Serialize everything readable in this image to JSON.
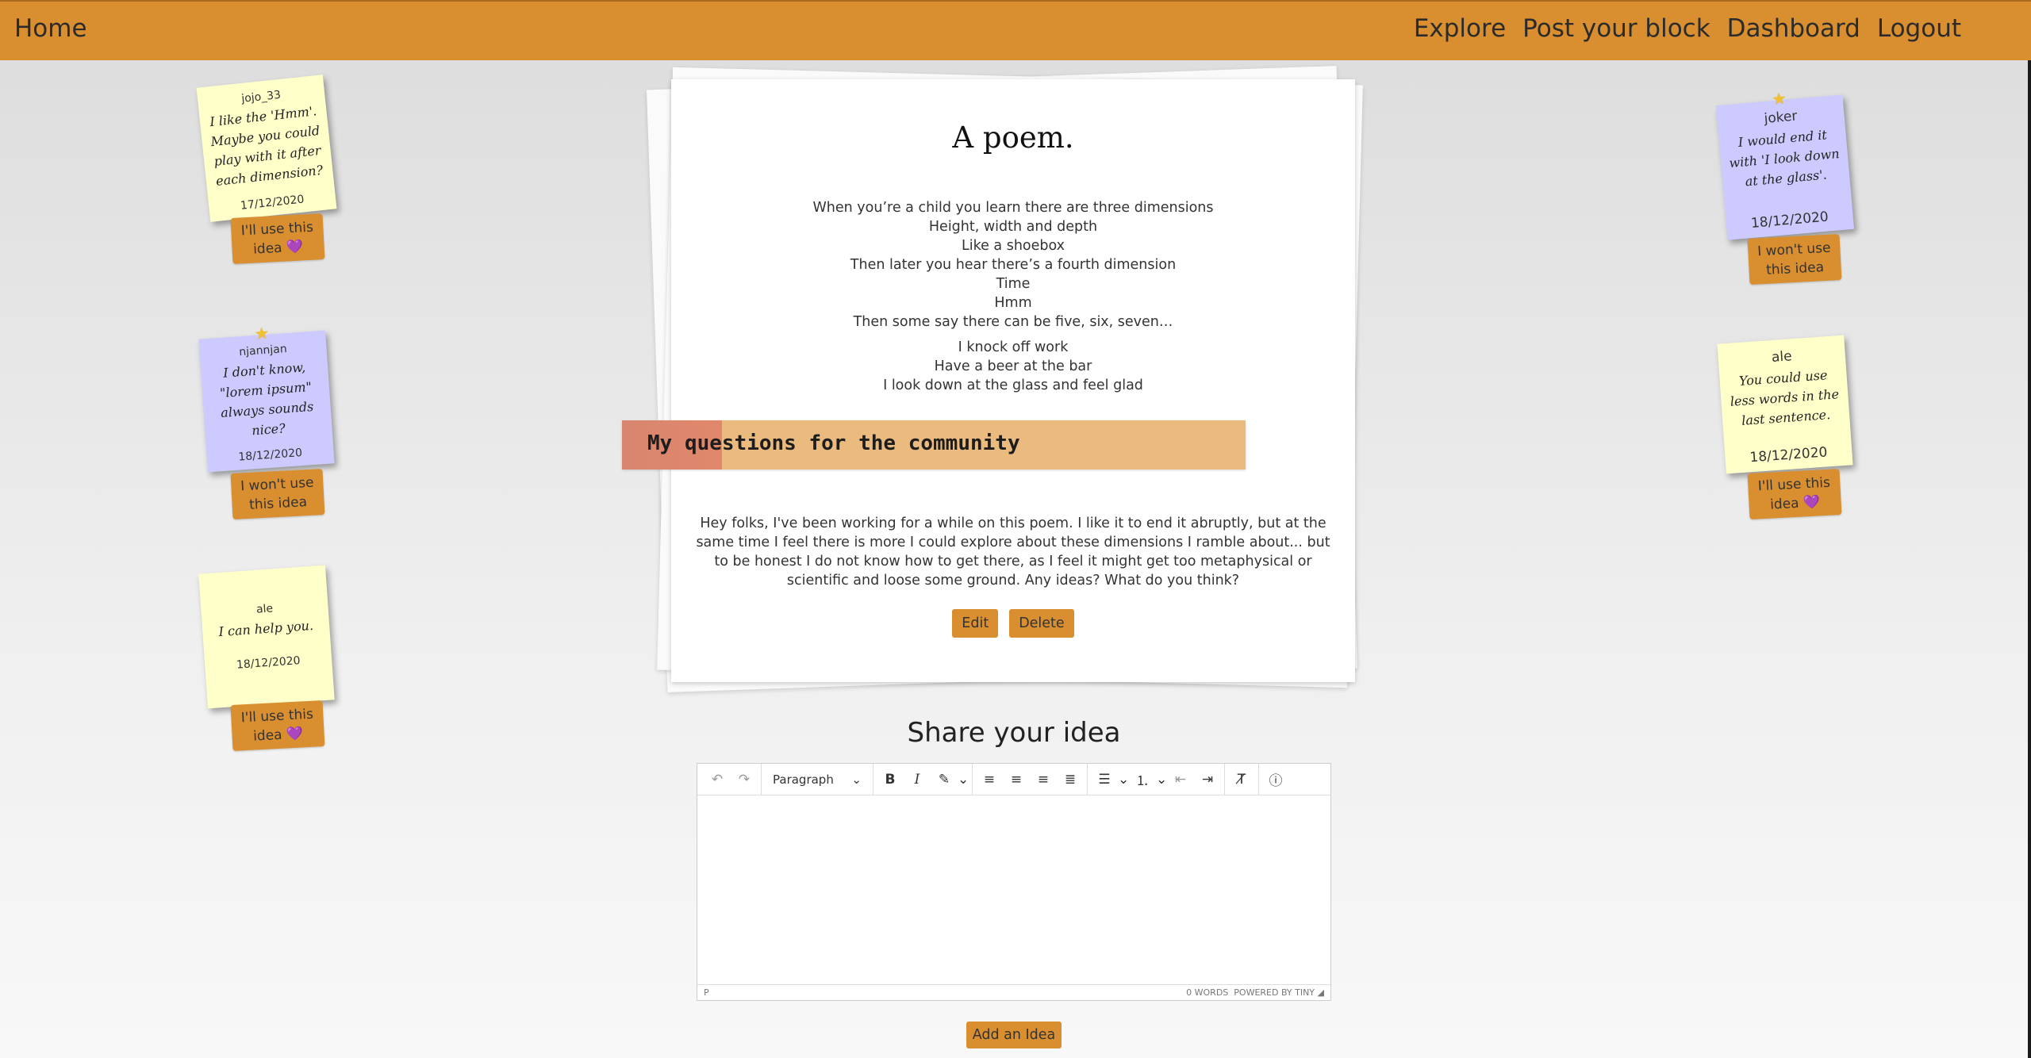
{
  "nav": {
    "home": "Home",
    "links": [
      "Explore",
      "Post your block",
      "Dashboard",
      "Logout"
    ]
  },
  "left_notes": [
    {
      "author": "jojo_33",
      "msg": "I like the 'Hmm'. Maybe you could play with it after each dimension?",
      "date": "17/12/2020",
      "button": "I'll use this idea",
      "starred": false,
      "color": "yellow"
    },
    {
      "author": "njannjan",
      "msg": "I don't know, \"lorem ipsum\" always sounds nice?",
      "date": "18/12/2020",
      "button": "I won't use this idea",
      "starred": true,
      "color": "purple"
    },
    {
      "author": "ale",
      "msg": "I can help you.",
      "date": "18/12/2020",
      "button": "I'll use this idea",
      "starred": false,
      "color": "yellow"
    }
  ],
  "right_notes": [
    {
      "author": "joker",
      "msg": "I would end it with 'I look down at the glass'.",
      "date": "18/12/2020",
      "button": "I won't use this idea",
      "starred": true,
      "color": "purple"
    },
    {
      "author": "ale",
      "msg": "You could use less words in the last sentence.",
      "date": "18/12/2020",
      "button": "I'll use this idea",
      "starred": false,
      "color": "yellow"
    }
  ],
  "card": {
    "title": "A poem.",
    "stanza1": [
      "When you’re a child you learn there are three dimensions",
      "Height, width and depth",
      "Like a shoebox",
      "Then later you hear there’s a fourth dimension",
      "Time",
      "Hmm",
      "Then some say there can be five, six, seven…"
    ],
    "stanza2": [
      "I knock off work",
      "Have a beer at the bar",
      "I look down at the glass and feel glad"
    ],
    "questions_label": "My questions for the community",
    "description": "Hey folks, I've been working for a while on this poem. I like it to end it abruptly, but at the same time I feel there is more I could explore about these dimensions I ramble about... but to be honest I do not know how to get there, as I feel it might get too metaphysical or scientific and loose some ground. Any ideas? What do you think?",
    "edit": "Edit",
    "delete": "Delete"
  },
  "share": {
    "title": "Share your idea",
    "block_format": "Paragraph",
    "status_path": "P",
    "word_count": "0 WORDS",
    "powered": "POWERED BY TINY",
    "add_button": "Add an Idea"
  },
  "colors": {
    "accent": "#d98e2f",
    "note_yellow": "#ffffc9",
    "note_purple": "#cccaff"
  }
}
